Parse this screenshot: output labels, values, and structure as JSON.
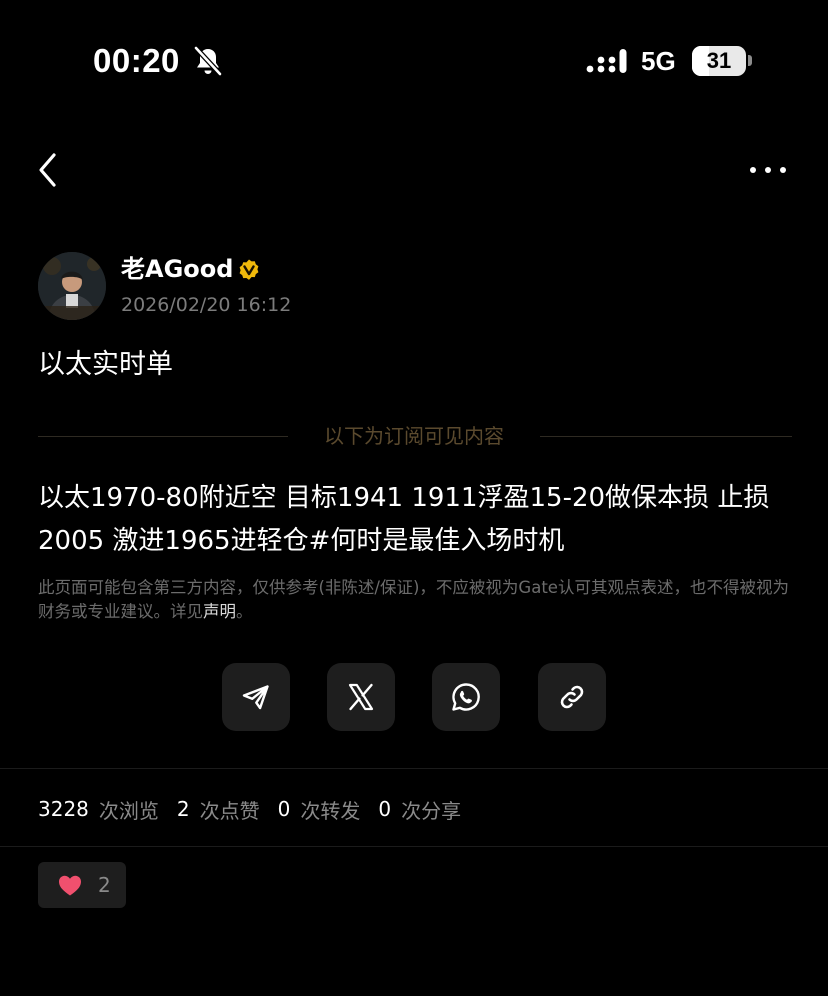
{
  "status_bar": {
    "time": "00:20",
    "network": "5G",
    "battery_level": "31",
    "battery_fraction": 0.31
  },
  "nav": {
    "back_icon": "chevron-left-icon",
    "more_icon": "more-dots-icon"
  },
  "author": {
    "name": "老AGood",
    "verified_icon": "verified-badge-icon",
    "time": "2026/02/20 16:12"
  },
  "post": {
    "title": "以太实时单",
    "divider_label": "以下为订阅可见内容",
    "body": "以太1970-80附近空 目标1941 1911浮盈15-20做保本损 止损2005 激进1965进轻仓#何时是最佳入场时机",
    "disclaimer_text": "此页面可能包含第三方内容，仅供参考(非陈述/保证)，不应被视为Gate认可其观点表述，也不得被视为财务或专业建议。详见",
    "disclaimer_link": "声明",
    "disclaimer_end": "。"
  },
  "share": {
    "buttons": [
      {
        "icon": "telegram-icon"
      },
      {
        "icon": "x-icon"
      },
      {
        "icon": "whatsapp-icon"
      },
      {
        "icon": "link-icon"
      }
    ]
  },
  "stats": {
    "views_count": "3228",
    "views_label": "次浏览",
    "likes_count": "2",
    "likes_label": "次点赞",
    "reposts_count": "0",
    "reposts_label": "次转发",
    "shares_count": "0",
    "shares_label": "次分享"
  },
  "reaction": {
    "icon": "heart-icon",
    "count": "2"
  },
  "colors": {
    "background": "#000000",
    "muted_text": "#7c7c7c",
    "divider_text": "#5b4a2e",
    "verified_gold": "#f0b90b",
    "heart_red": "#f0506e",
    "button_bg": "#1e1e1e"
  }
}
